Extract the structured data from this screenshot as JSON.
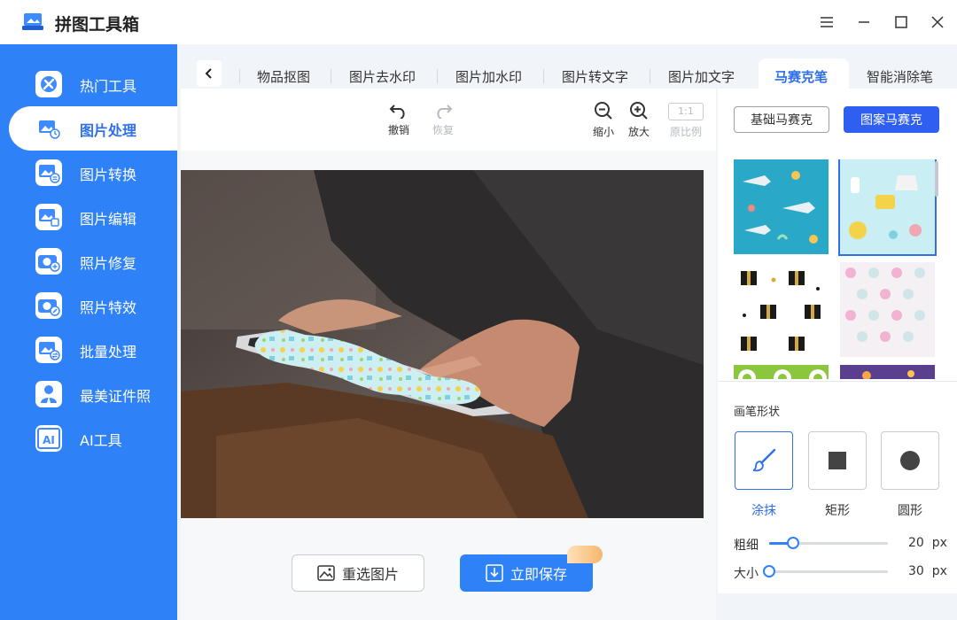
{
  "app": {
    "title": "拼图工具箱"
  },
  "window": {
    "menu_icon": "menu-icon",
    "minimize_icon": "minimize-icon",
    "maximize_icon": "maximize-icon",
    "close_icon": "close-icon"
  },
  "sidebar": {
    "items": [
      {
        "label": "热门工具",
        "icon": "gear-tools-icon",
        "active": false
      },
      {
        "label": "图片处理",
        "icon": "image-process-icon",
        "active": true
      },
      {
        "label": "图片转换",
        "icon": "image-convert-icon",
        "active": false
      },
      {
        "label": "图片编辑",
        "icon": "image-edit-icon",
        "active": false
      },
      {
        "label": "照片修复",
        "icon": "camera-repair-icon",
        "active": false
      },
      {
        "label": "照片特效",
        "icon": "camera-effect-icon",
        "active": false
      },
      {
        "label": "批量处理",
        "icon": "batch-icon",
        "active": false
      },
      {
        "label": "最美证件照",
        "icon": "id-photo-icon",
        "active": false
      },
      {
        "label": "AI工具",
        "icon": "ai-icon",
        "active": false
      }
    ]
  },
  "tabs": {
    "items": [
      {
        "label": "物品抠图"
      },
      {
        "label": "图片去水印"
      },
      {
        "label": "图片加水印"
      },
      {
        "label": "图片转文字"
      },
      {
        "label": "图片加文字"
      },
      {
        "label": "马赛克笔",
        "active": true
      },
      {
        "label": "智能消除笔"
      }
    ]
  },
  "toolbar": {
    "undo": "撤销",
    "redo": "恢复",
    "zoom_out": "缩小",
    "zoom_in": "放大",
    "original_ratio": "原比例",
    "ratio_text": "1:1"
  },
  "actions": {
    "reselect": "重选图片",
    "save": "立即保存"
  },
  "mosaic": {
    "basic_label": "基础马赛克",
    "pattern_label": "图案马赛克",
    "active_mode": "图案马赛克",
    "patterns": [
      "ocean-sharks",
      "baby-toys",
      "gift-boxes",
      "pastel-dots",
      "green-circles",
      "purple-space"
    ],
    "selected_pattern": "baby-toys"
  },
  "brush": {
    "title": "画笔形状",
    "shapes": [
      {
        "label": "涂抹",
        "icon": "brush-icon",
        "active": true
      },
      {
        "label": "矩形",
        "icon": "square-icon",
        "active": false
      },
      {
        "label": "圆形",
        "icon": "circle-icon",
        "active": false
      }
    ],
    "thickness_label": "粗细",
    "thickness_value": "20",
    "thickness_unit": "px",
    "thickness_fraction": 0.2,
    "size_label": "大小",
    "size_value": "30",
    "size_unit": "px",
    "size_fraction": 0.0
  },
  "colors": {
    "accent": "#2f81f7",
    "sidebar": "#2f81f7",
    "active_tab": "#2f6fe8",
    "pattern_button": "#2f5ff0"
  }
}
